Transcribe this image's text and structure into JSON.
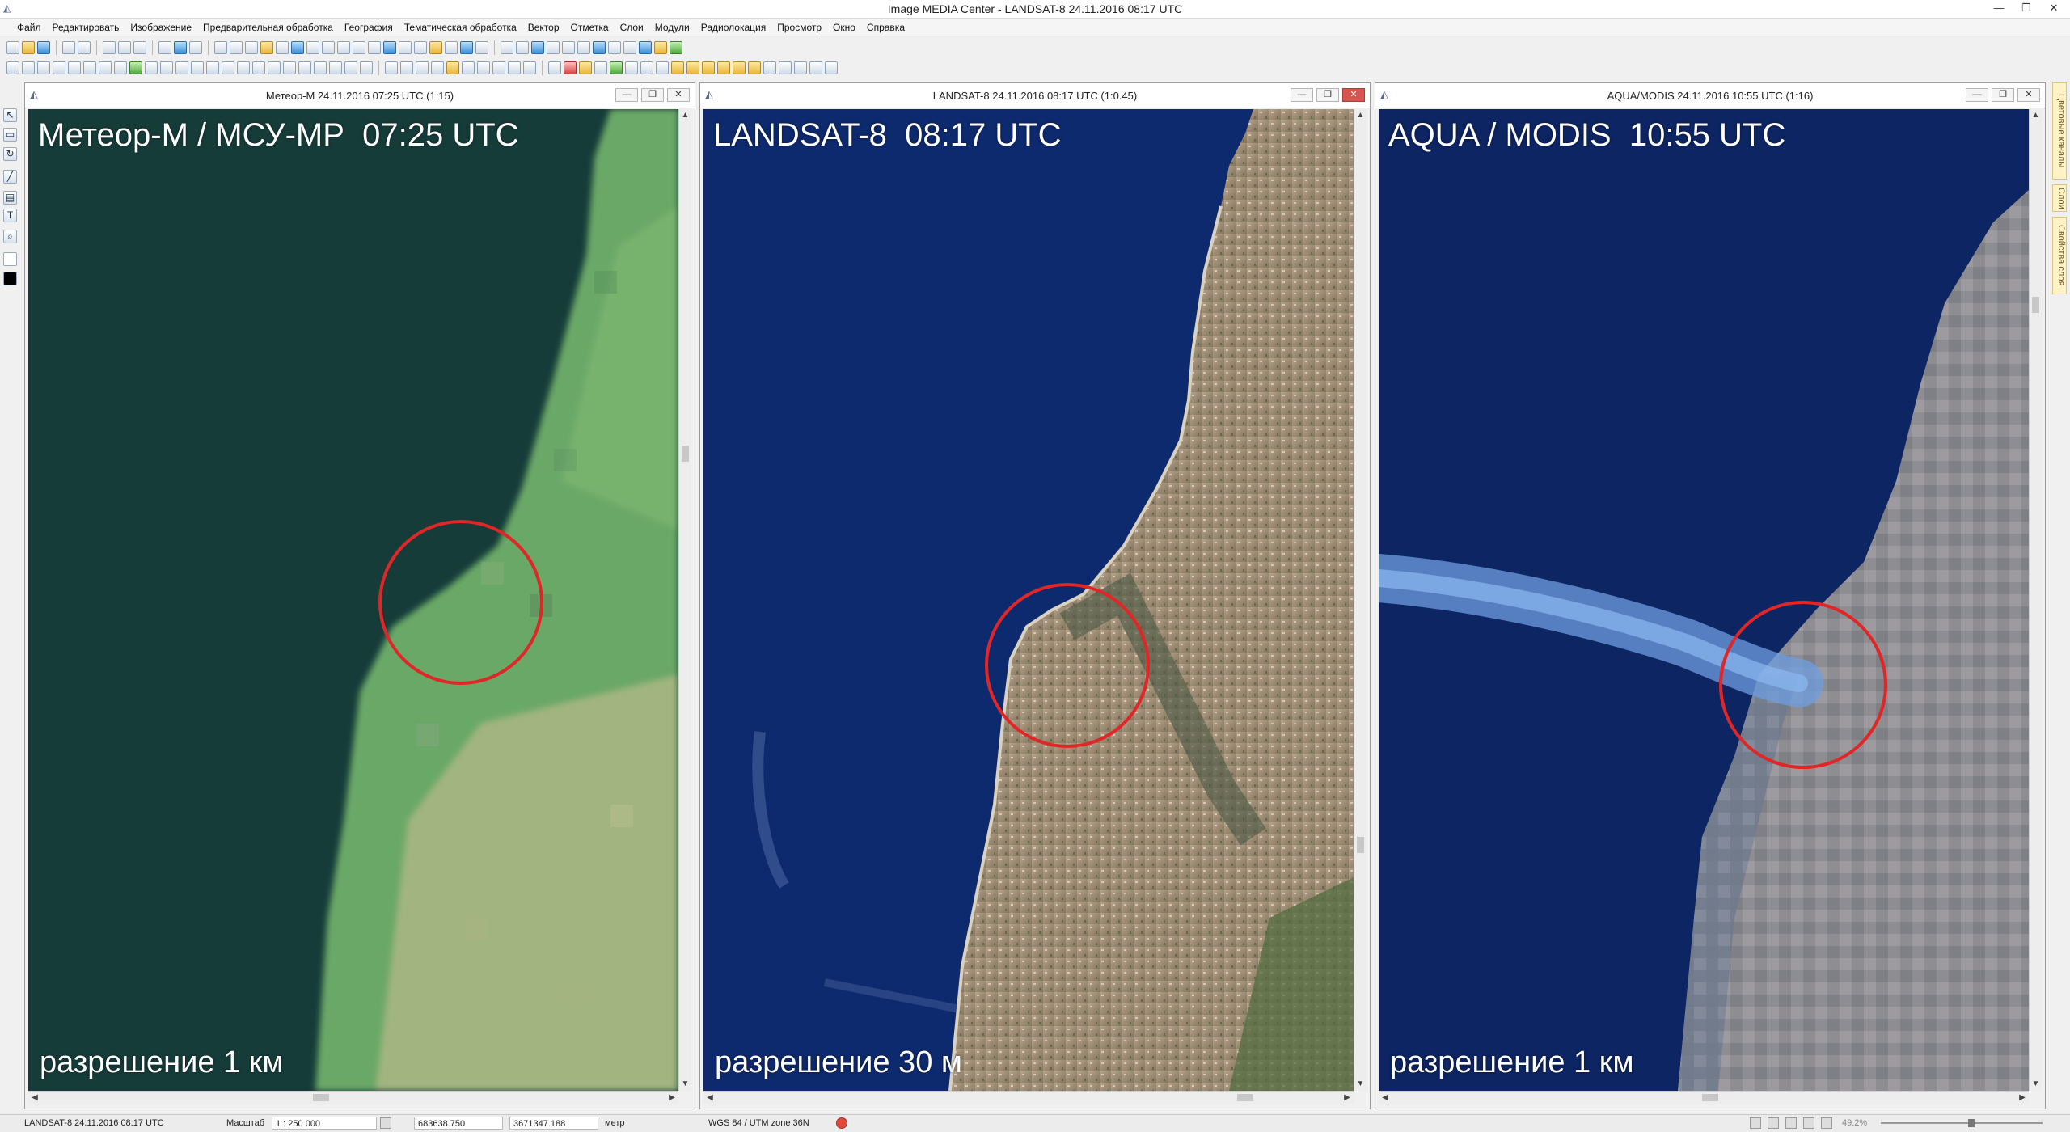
{
  "app": {
    "title": "Image MEDIA Center - LANDSAT-8 24.11.2016 08:17 UTC",
    "window_buttons": [
      "—",
      "❐",
      "✕"
    ]
  },
  "menu": [
    "Файл",
    "Редактировать",
    "Изображение",
    "Предварительная обработка",
    "География",
    "Тематическая обработка",
    "Вектор",
    "Отметка",
    "Слои",
    "Модули",
    "Радиолокация",
    "Просмотр",
    "Окно",
    "Справка"
  ],
  "right_tabs": [
    "Цветовые каналы",
    "Слои",
    "Свойства слоя"
  ],
  "windows": [
    {
      "title": "Метеор-М 24.11.2016 07:25 UTC     (1:15)",
      "caption_top": "Метеор-М / МСУ-МР  07:25 UTC",
      "caption_bottom": "разрешение 1 км",
      "buttons": [
        "—",
        "❐",
        "✕"
      ]
    },
    {
      "title": "LANDSAT-8 24.11.2016 08:17 UTC     (1:0.45)",
      "caption_top": "LANDSAT-8  08:17 UTC",
      "caption_bottom": "разрешение 30 м",
      "buttons": [
        "—",
        "❐",
        "✕"
      ]
    },
    {
      "title": "AQUA/MODIS 24.11.2016 10:55 UTC     (1:16)",
      "caption_top": "AQUA / MODIS  10:55 UTC",
      "caption_bottom": "разрешение 1 км",
      "buttons": [
        "—",
        "❐",
        "✕"
      ]
    }
  ],
  "status": {
    "layer": "LANDSAT-8 24.11.2016 08:17 UTC",
    "scale_label": "Масштаб",
    "scale_value": "1 : 250 000",
    "x": "683638.750",
    "y": "3671347.188",
    "units": "метр",
    "projection": "WGS 84 / UTM zone 36N",
    "zoom": "49.2%"
  },
  "colors": {
    "sea_meteor": "#163c3a",
    "sea_landsat": "#0e2a6e",
    "sea_modis": "#0d2563",
    "circle": "#e02626"
  }
}
